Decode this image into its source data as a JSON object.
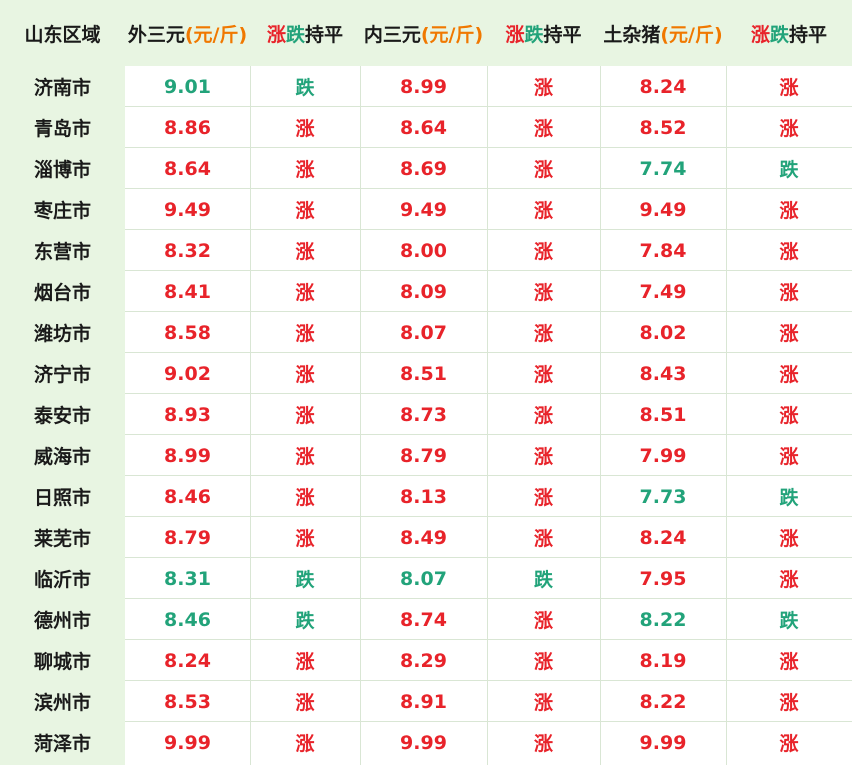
{
  "colors": {
    "up": "#e8232a",
    "down": "#22a37a",
    "unit": "#f07800",
    "header_bg": "#e8f5e2"
  },
  "header": {
    "region": "山东区域",
    "outer_label": "外三元",
    "inner_label": "内三元",
    "local_label": "土杂猪",
    "unit": "(元/斤)",
    "trend_up": "涨",
    "trend_down": "跌",
    "trend_flat": "持平"
  },
  "rows": [
    {
      "region": "济南市",
      "outer": "9.01",
      "outer_trend": "跌",
      "inner": "8.99",
      "inner_trend": "涨",
      "local": "8.24",
      "local_trend": "涨"
    },
    {
      "region": "青岛市",
      "outer": "8.86",
      "outer_trend": "涨",
      "inner": "8.64",
      "inner_trend": "涨",
      "local": "8.52",
      "local_trend": "涨"
    },
    {
      "region": "淄博市",
      "outer": "8.64",
      "outer_trend": "涨",
      "inner": "8.69",
      "inner_trend": "涨",
      "local": "7.74",
      "local_trend": "跌"
    },
    {
      "region": "枣庄市",
      "outer": "9.49",
      "outer_trend": "涨",
      "inner": "9.49",
      "inner_trend": "涨",
      "local": "9.49",
      "local_trend": "涨"
    },
    {
      "region": "东营市",
      "outer": "8.32",
      "outer_trend": "涨",
      "inner": "8.00",
      "inner_trend": "涨",
      "local": "7.84",
      "local_trend": "涨"
    },
    {
      "region": "烟台市",
      "outer": "8.41",
      "outer_trend": "涨",
      "inner": "8.09",
      "inner_trend": "涨",
      "local": "7.49",
      "local_trend": "涨"
    },
    {
      "region": "潍坊市",
      "outer": "8.58",
      "outer_trend": "涨",
      "inner": "8.07",
      "inner_trend": "涨",
      "local": "8.02",
      "local_trend": "涨"
    },
    {
      "region": "济宁市",
      "outer": "9.02",
      "outer_trend": "涨",
      "inner": "8.51",
      "inner_trend": "涨",
      "local": "8.43",
      "local_trend": "涨"
    },
    {
      "region": "泰安市",
      "outer": "8.93",
      "outer_trend": "涨",
      "inner": "8.73",
      "inner_trend": "涨",
      "local": "8.51",
      "local_trend": "涨"
    },
    {
      "region": "威海市",
      "outer": "8.99",
      "outer_trend": "涨",
      "inner": "8.79",
      "inner_trend": "涨",
      "local": "7.99",
      "local_trend": "涨"
    },
    {
      "region": "日照市",
      "outer": "8.46",
      "outer_trend": "涨",
      "inner": "8.13",
      "inner_trend": "涨",
      "local": "7.73",
      "local_trend": "跌"
    },
    {
      "region": "莱芜市",
      "outer": "8.79",
      "outer_trend": "涨",
      "inner": "8.49",
      "inner_trend": "涨",
      "local": "8.24",
      "local_trend": "涨"
    },
    {
      "region": "临沂市",
      "outer": "8.31",
      "outer_trend": "跌",
      "inner": "8.07",
      "inner_trend": "跌",
      "local": "7.95",
      "local_trend": "涨"
    },
    {
      "region": "德州市",
      "outer": "8.46",
      "outer_trend": "跌",
      "inner": "8.74",
      "inner_trend": "涨",
      "local": "8.22",
      "local_trend": "跌"
    },
    {
      "region": "聊城市",
      "outer": "8.24",
      "outer_trend": "涨",
      "inner": "8.29",
      "inner_trend": "涨",
      "local": "8.19",
      "local_trend": "涨"
    },
    {
      "region": "滨州市",
      "outer": "8.53",
      "outer_trend": "涨",
      "inner": "8.91",
      "inner_trend": "涨",
      "local": "8.22",
      "local_trend": "涨"
    },
    {
      "region": "菏泽市",
      "outer": "9.99",
      "outer_trend": "涨",
      "inner": "9.99",
      "inner_trend": "涨",
      "local": "9.99",
      "local_trend": "涨"
    }
  ]
}
